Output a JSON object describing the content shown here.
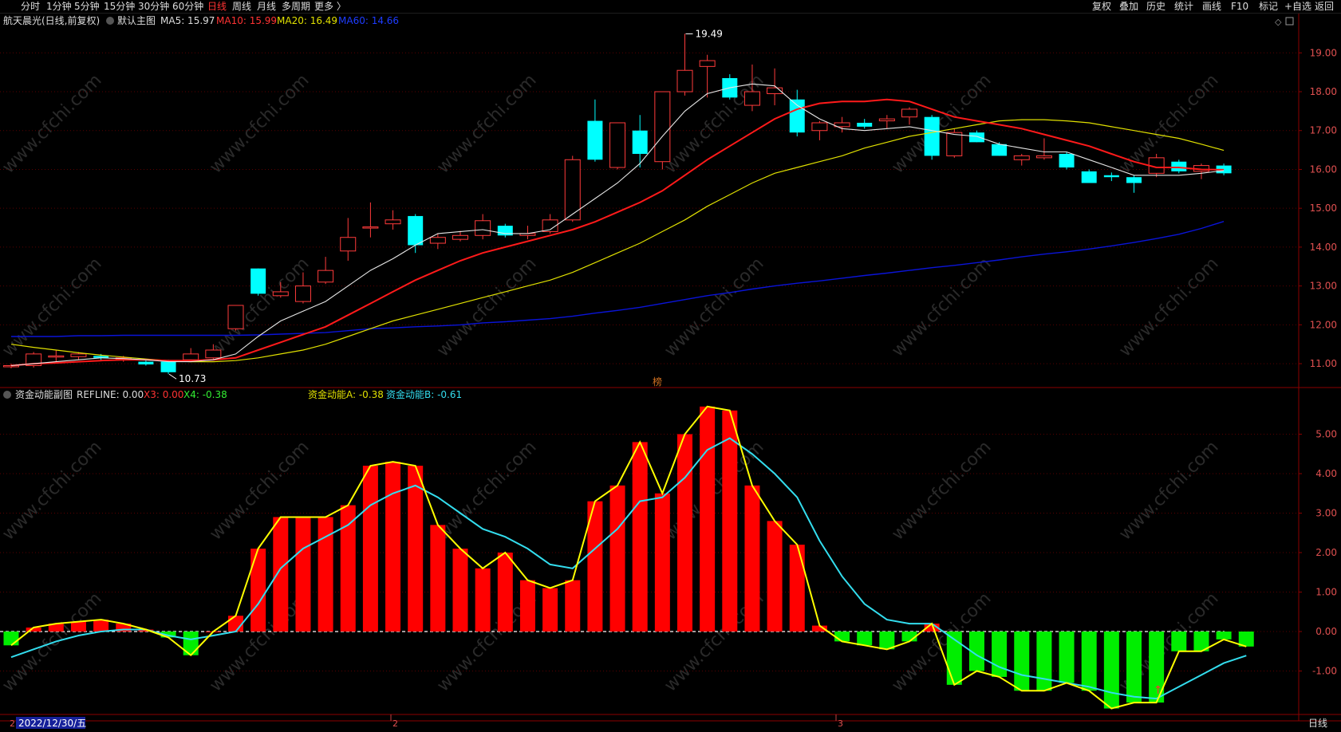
{
  "toolbar": {
    "periods": [
      "分时",
      "1分钟",
      "5分钟",
      "15分钟",
      "30分钟",
      "60分钟",
      "日线",
      "周线",
      "月线",
      "多周期",
      "更多 〉"
    ],
    "active_period": "日线",
    "tools": [
      "复权",
      "叠加",
      "历史",
      "统计",
      "画线",
      "F10",
      "标记",
      "+自选",
      "返回"
    ]
  },
  "main_header": {
    "stock": "航天晨光(日线,前复权)",
    "template": "默认主图",
    "ma5": "MA5: 15.97",
    "ma10": "MA10: 15.99",
    "ma20": "MA20: 16.49",
    "ma60": "MA60: 14.66"
  },
  "sub_header": {
    "name": "资金动能副图",
    "refline": "REFLINE: 0.00",
    "x3": "X3: 0.00",
    "x4": "X4: -0.38",
    "a": "资金动能A: -0.38",
    "b": "资金动能B: -0.61"
  },
  "bottom": {
    "date": "2022/12/30/五",
    "left_marker": "2",
    "month2": "2",
    "month3": "3",
    "period_label": "日线"
  },
  "center_label": "榜",
  "watermark": "www.cfchi.com",
  "colors": {
    "up": "#ff3b3b",
    "down": "#00ffff",
    "ma5": "#e6e6e6",
    "ma10": "#ff1a1a",
    "ma20": "#e0e000",
    "ma60": "#0a14d8",
    "pos_bar": "#ff0000",
    "neg_bar": "#00ee00",
    "line_a": "#ffff00",
    "line_b": "#33ddee"
  },
  "chart_data": [
    {
      "type": "candlestick",
      "title": "航天晨光(日线,前复权)",
      "yticks": [
        "11.00",
        "12.00",
        "13.00",
        "14.00",
        "15.00",
        "16.00",
        "17.00",
        "18.00",
        "19.00"
      ],
      "ylim": [
        10.55,
        19.95
      ],
      "annotations": [
        {
          "text": "19.49",
          "candle": 30,
          "value": 19.49
        },
        {
          "text": "10.73",
          "candle": 7,
          "value": 10.73
        }
      ],
      "candles": [
        {
          "o": 10.95,
          "h": 11.0,
          "l": 10.88,
          "c": 10.95
        },
        {
          "o": 10.95,
          "h": 11.3,
          "l": 10.9,
          "c": 11.25
        },
        {
          "o": 11.2,
          "h": 11.35,
          "l": 11.05,
          "c": 11.2
        },
        {
          "o": 11.18,
          "h": 11.3,
          "l": 11.1,
          "c": 11.25
        },
        {
          "o": 11.2,
          "h": 11.25,
          "l": 11.08,
          "c": 11.15
        },
        {
          "o": 11.12,
          "h": 11.2,
          "l": 11.05,
          "c": 11.15
        },
        {
          "o": 11.05,
          "h": 11.1,
          "l": 10.95,
          "c": 10.98
        },
        {
          "o": 11.05,
          "h": 11.1,
          "l": 10.73,
          "c": 10.78
        },
        {
          "o": 11.1,
          "h": 11.4,
          "l": 11.05,
          "c": 11.25
        },
        {
          "o": 11.15,
          "h": 11.5,
          "l": 11.1,
          "c": 11.35
        },
        {
          "o": 11.9,
          "h": 12.5,
          "l": 11.85,
          "c": 12.5
        },
        {
          "o": 13.45,
          "h": 13.45,
          "l": 12.75,
          "c": 12.8
        },
        {
          "o": 12.75,
          "h": 13.1,
          "l": 12.7,
          "c": 12.85
        },
        {
          "o": 12.6,
          "h": 13.35,
          "l": 12.55,
          "c": 13.0
        },
        {
          "o": 13.1,
          "h": 13.75,
          "l": 13.05,
          "c": 13.4
        },
        {
          "o": 13.9,
          "h": 14.75,
          "l": 13.65,
          "c": 14.25
        },
        {
          "o": 14.52,
          "h": 15.15,
          "l": 14.25,
          "c": 14.52
        },
        {
          "o": 14.6,
          "h": 14.95,
          "l": 14.45,
          "c": 14.7
        },
        {
          "o": 14.8,
          "h": 14.85,
          "l": 13.85,
          "c": 14.05
        },
        {
          "o": 14.1,
          "h": 14.35,
          "l": 13.95,
          "c": 14.25
        },
        {
          "o": 14.2,
          "h": 14.42,
          "l": 14.15,
          "c": 14.3
        },
        {
          "o": 14.3,
          "h": 14.85,
          "l": 14.2,
          "c": 14.68
        },
        {
          "o": 14.55,
          "h": 14.6,
          "l": 14.25,
          "c": 14.3
        },
        {
          "o": 14.3,
          "h": 14.55,
          "l": 14.2,
          "c": 14.35
        },
        {
          "o": 14.4,
          "h": 14.85,
          "l": 14.35,
          "c": 14.7
        },
        {
          "o": 14.7,
          "h": 16.35,
          "l": 14.65,
          "c": 16.25
        },
        {
          "o": 17.25,
          "h": 17.8,
          "l": 16.2,
          "c": 16.25
        },
        {
          "o": 16.05,
          "h": 17.2,
          "l": 16.0,
          "c": 17.2
        },
        {
          "o": 17.0,
          "h": 17.4,
          "l": 16.05,
          "c": 16.4
        },
        {
          "o": 16.2,
          "h": 18.0,
          "l": 16.0,
          "c": 18.0
        },
        {
          "o": 18.0,
          "h": 19.49,
          "l": 17.9,
          "c": 18.55
        },
        {
          "o": 18.65,
          "h": 18.95,
          "l": 17.85,
          "c": 18.8
        },
        {
          "o": 18.35,
          "h": 18.45,
          "l": 17.8,
          "c": 17.85
        },
        {
          "o": 17.65,
          "h": 18.7,
          "l": 17.5,
          "c": 18.0
        },
        {
          "o": 17.95,
          "h": 18.6,
          "l": 17.65,
          "c": 18.1
        },
        {
          "o": 17.8,
          "h": 18.05,
          "l": 16.85,
          "c": 16.95
        },
        {
          "o": 17.0,
          "h": 17.25,
          "l": 16.75,
          "c": 17.2
        },
        {
          "o": 17.1,
          "h": 17.35,
          "l": 16.95,
          "c": 17.2
        },
        {
          "o": 17.2,
          "h": 17.3,
          "l": 17.05,
          "c": 17.1
        },
        {
          "o": 17.25,
          "h": 17.4,
          "l": 17.05,
          "c": 17.3
        },
        {
          "o": 17.35,
          "h": 17.6,
          "l": 17.15,
          "c": 17.55
        },
        {
          "o": 17.35,
          "h": 17.4,
          "l": 16.25,
          "c": 16.35
        },
        {
          "o": 16.35,
          "h": 17.05,
          "l": 16.3,
          "c": 16.95
        },
        {
          "o": 16.95,
          "h": 17.0,
          "l": 16.7,
          "c": 16.7
        },
        {
          "o": 16.65,
          "h": 16.7,
          "l": 16.35,
          "c": 16.35
        },
        {
          "o": 16.25,
          "h": 16.4,
          "l": 16.1,
          "c": 16.35
        },
        {
          "o": 16.3,
          "h": 16.8,
          "l": 16.25,
          "c": 16.35
        },
        {
          "o": 16.4,
          "h": 16.45,
          "l": 16.0,
          "c": 16.05
        },
        {
          "o": 15.95,
          "h": 16.0,
          "l": 15.65,
          "c": 15.65
        },
        {
          "o": 15.85,
          "h": 15.92,
          "l": 15.7,
          "c": 15.8
        },
        {
          "o": 15.8,
          "h": 15.85,
          "l": 15.4,
          "c": 15.65
        },
        {
          "o": 15.9,
          "h": 16.4,
          "l": 15.8,
          "c": 16.3
        },
        {
          "o": 16.2,
          "h": 16.25,
          "l": 15.9,
          "c": 15.95
        },
        {
          "o": 15.95,
          "h": 16.15,
          "l": 15.75,
          "c": 16.1
        },
        {
          "o": 16.1,
          "h": 16.15,
          "l": 15.85,
          "c": 15.9
        }
      ],
      "ma5": [
        10.95,
        11.0,
        11.05,
        11.1,
        11.15,
        11.13,
        11.1,
        11.05,
        11.05,
        11.1,
        11.25,
        11.7,
        12.1,
        12.35,
        12.6,
        13.0,
        13.4,
        13.7,
        14.05,
        14.35,
        14.4,
        14.45,
        14.35,
        14.35,
        14.45,
        14.85,
        15.25,
        15.65,
        16.15,
        16.85,
        17.5,
        17.95,
        18.1,
        18.2,
        18.15,
        17.65,
        17.3,
        17.05,
        17.0,
        17.05,
        17.1,
        17.0,
        16.9,
        16.85,
        16.65,
        16.55,
        16.45,
        16.45,
        16.25,
        16.05,
        15.85,
        15.85,
        15.85,
        15.9,
        15.97
      ],
      "ma10": [
        10.95,
        11.0,
        11.02,
        11.05,
        11.08,
        11.1,
        11.1,
        11.08,
        11.08,
        11.1,
        11.15,
        11.35,
        11.55,
        11.75,
        11.95,
        12.25,
        12.55,
        12.85,
        13.15,
        13.4,
        13.65,
        13.85,
        14.0,
        14.15,
        14.3,
        14.45,
        14.65,
        14.9,
        15.15,
        15.45,
        15.85,
        16.25,
        16.6,
        16.95,
        17.3,
        17.55,
        17.7,
        17.75,
        17.75,
        17.8,
        17.75,
        17.55,
        17.35,
        17.25,
        17.15,
        17.05,
        16.9,
        16.75,
        16.6,
        16.4,
        16.2,
        16.05,
        16.05,
        16.0,
        15.99
      ],
      "ma20": [
        11.5,
        11.42,
        11.35,
        11.28,
        11.22,
        11.17,
        11.12,
        11.08,
        11.05,
        11.05,
        11.08,
        11.15,
        11.25,
        11.35,
        11.5,
        11.7,
        11.9,
        12.1,
        12.25,
        12.4,
        12.55,
        12.7,
        12.85,
        13.0,
        13.15,
        13.35,
        13.6,
        13.85,
        14.1,
        14.4,
        14.7,
        15.05,
        15.35,
        15.65,
        15.9,
        16.05,
        16.2,
        16.35,
        16.55,
        16.7,
        16.85,
        16.95,
        17.05,
        17.15,
        17.25,
        17.28,
        17.28,
        17.25,
        17.2,
        17.1,
        17.0,
        16.9,
        16.8,
        16.65,
        16.49
      ],
      "ma60": [
        11.7,
        11.7,
        11.7,
        11.72,
        11.72,
        11.73,
        11.73,
        11.73,
        11.73,
        11.73,
        11.73,
        11.74,
        11.76,
        11.78,
        11.8,
        11.85,
        11.9,
        11.92,
        11.95,
        11.97,
        12.0,
        12.05,
        12.08,
        12.12,
        12.16,
        12.22,
        12.3,
        12.37,
        12.45,
        12.55,
        12.65,
        12.75,
        12.83,
        12.92,
        13.0,
        13.07,
        13.13,
        13.2,
        13.27,
        13.33,
        13.4,
        13.47,
        13.53,
        13.6,
        13.67,
        13.75,
        13.82,
        13.88,
        13.95,
        14.03,
        14.12,
        14.22,
        14.33,
        14.48,
        14.66
      ]
    },
    {
      "type": "bar",
      "title": "资金动能副图",
      "yticks": [
        "-1.00",
        "0.00",
        "1.00",
        "2.00",
        "3.00",
        "4.00",
        "5.00"
      ],
      "ylim": [
        -2.1,
        5.8
      ],
      "x3": [
        -0.35,
        0.1,
        0.2,
        0.25,
        0.3,
        0.2,
        0.05,
        -0.15,
        -0.6,
        0.0,
        0.4,
        2.1,
        2.9,
        2.9,
        2.9,
        3.2,
        4.2,
        4.3,
        4.2,
        2.7,
        2.1,
        1.6,
        2.0,
        1.3,
        1.1,
        1.3,
        3.3,
        3.7,
        4.8,
        3.5,
        5.0,
        5.7,
        5.6,
        3.7,
        2.8,
        2.2,
        0.15,
        -0.25,
        -0.35,
        -0.45,
        -0.25,
        0.2,
        -1.35,
        -1.0,
        -1.15,
        -1.5,
        -1.5,
        -1.3,
        -1.5,
        -1.95,
        -1.8,
        -1.8,
        -0.5,
        -0.5,
        -0.2,
        -0.38
      ],
      "line_a": [
        -0.35,
        0.1,
        0.2,
        0.25,
        0.3,
        0.2,
        0.05,
        -0.15,
        -0.6,
        0.0,
        0.4,
        2.1,
        2.9,
        2.9,
        2.9,
        3.2,
        4.2,
        4.3,
        4.2,
        2.7,
        2.1,
        1.6,
        2.0,
        1.3,
        1.1,
        1.3,
        3.3,
        3.7,
        4.8,
        3.5,
        5.0,
        5.7,
        5.6,
        3.7,
        2.8,
        2.2,
        0.15,
        -0.25,
        -0.35,
        -0.45,
        -0.25,
        0.2,
        -1.35,
        -1.0,
        -1.15,
        -1.5,
        -1.5,
        -1.3,
        -1.5,
        -1.95,
        -1.8,
        -1.8,
        -0.5,
        -0.5,
        -0.2,
        -0.38
      ],
      "line_b": [
        -0.65,
        -0.45,
        -0.25,
        -0.1,
        0.0,
        0.05,
        0.05,
        -0.1,
        -0.2,
        -0.1,
        0.0,
        0.7,
        1.6,
        2.1,
        2.4,
        2.7,
        3.2,
        3.5,
        3.7,
        3.4,
        3.0,
        2.6,
        2.4,
        2.1,
        1.7,
        1.6,
        2.1,
        2.6,
        3.3,
        3.4,
        3.9,
        4.6,
        4.9,
        4.5,
        4.0,
        3.4,
        2.3,
        1.4,
        0.7,
        0.3,
        0.2,
        0.2,
        -0.2,
        -0.6,
        -0.9,
        -1.1,
        -1.2,
        -1.3,
        -1.4,
        -1.55,
        -1.65,
        -1.7,
        -1.4,
        -1.1,
        -0.8,
        -0.61
      ]
    }
  ]
}
